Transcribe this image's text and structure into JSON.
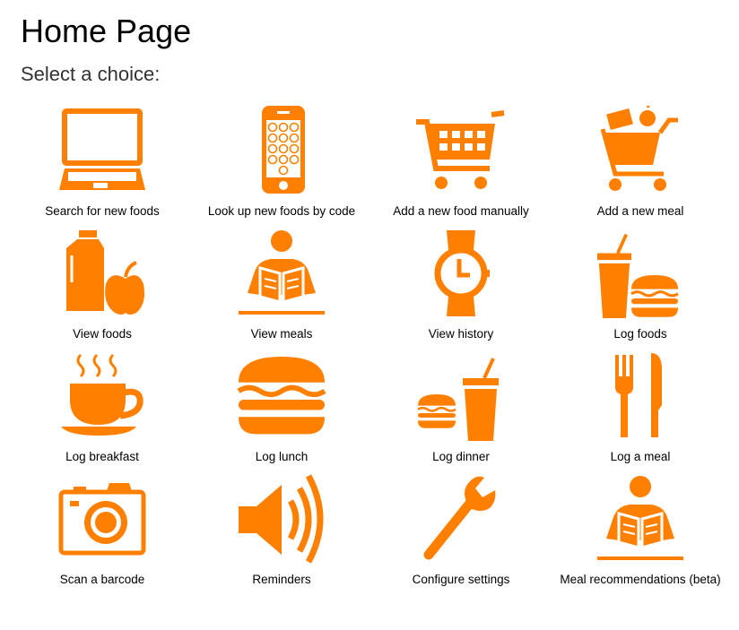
{
  "header": {
    "title": "Home Page",
    "subtitle": "Select a choice:"
  },
  "accent": "#FF8000",
  "tiles": [
    {
      "label": "Search for new foods",
      "icon": "laptop-icon"
    },
    {
      "label": "Look up new foods by code",
      "icon": "phone-keypad-icon"
    },
    {
      "label": "Add a new food manually",
      "icon": "shopping-cart-icon"
    },
    {
      "label": "Add a new meal",
      "icon": "grocery-cart-icon"
    },
    {
      "label": "View foods",
      "icon": "milk-apple-icon"
    },
    {
      "label": "View meals",
      "icon": "reader-icon"
    },
    {
      "label": "View history",
      "icon": "watch-icon"
    },
    {
      "label": "Log foods",
      "icon": "drink-burger-icon"
    },
    {
      "label": "Log breakfast",
      "icon": "coffee-cup-icon"
    },
    {
      "label": "Log lunch",
      "icon": "burger-icon"
    },
    {
      "label": "Log dinner",
      "icon": "burger-drink-icon"
    },
    {
      "label": "Log a meal",
      "icon": "fork-knife-icon"
    },
    {
      "label": "Scan a barcode",
      "icon": "camera-icon"
    },
    {
      "label": "Reminders",
      "icon": "speaker-icon"
    },
    {
      "label": "Configure settings",
      "icon": "wrench-icon"
    },
    {
      "label": "Meal recommendations (beta)",
      "icon": "reader-icon"
    }
  ]
}
